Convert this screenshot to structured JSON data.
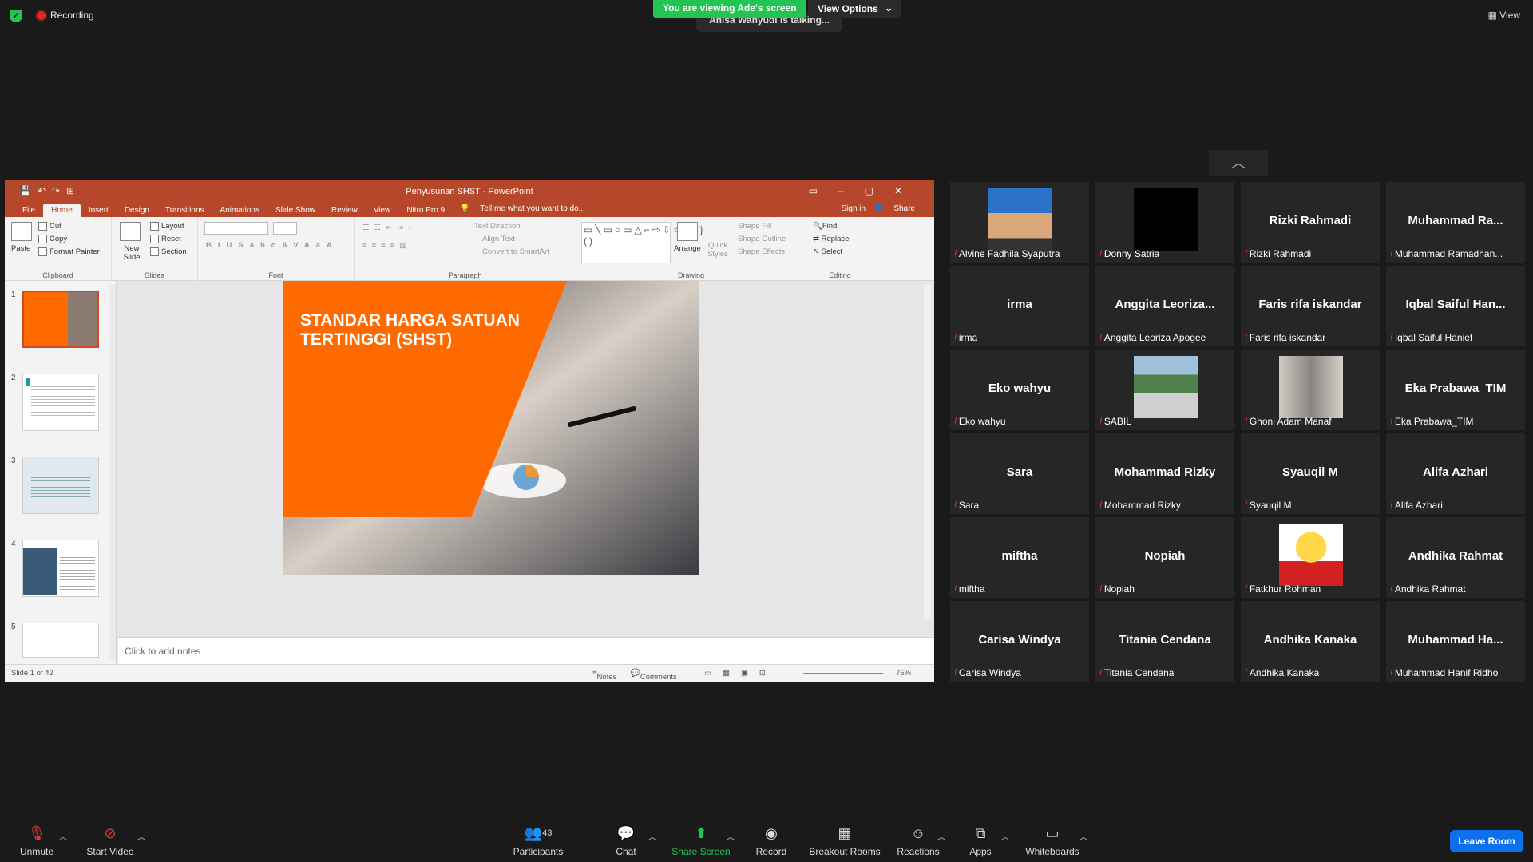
{
  "meeting": {
    "recording_label": "Recording",
    "viewing_banner": "You are viewing Ade's screen",
    "view_options_label": "View Options",
    "talking_indicator": "Anisa Wahyudi is talking...",
    "view_button": "View"
  },
  "ppt": {
    "window_title": "Penyusunan SHST - PowerPoint",
    "tabs": [
      "File",
      "Home",
      "Insert",
      "Design",
      "Transitions",
      "Animations",
      "Slide Show",
      "Review",
      "View",
      "Nitro Pro 9"
    ],
    "active_tab": "Home",
    "tell_me": "Tell me what you want to do...",
    "sign_in": "Sign in",
    "share": "Share",
    "ribbon": {
      "clipboard": {
        "paste": "Paste",
        "cut": "Cut",
        "copy": "Copy",
        "format_painter": "Format Painter",
        "label": "Clipboard"
      },
      "slides": {
        "new_slide": "New Slide",
        "layout": "Layout",
        "reset": "Reset",
        "section": "Section",
        "label": "Slides"
      },
      "font": {
        "label": "Font"
      },
      "paragraph": {
        "text_direction": "Text Direction",
        "align_text": "Align Text",
        "convert_smartart": "Convert to SmartArt",
        "label": "Paragraph"
      },
      "drawing": {
        "arrange": "Arrange",
        "quick_styles": "Quick Styles",
        "shape_fill": "Shape Fill",
        "shape_outline": "Shape Outline",
        "shape_effects": "Shape Effects",
        "label": "Drawing"
      },
      "editing": {
        "find": "Find",
        "replace": "Replace",
        "select": "Select",
        "label": "Editing"
      }
    },
    "thumbnail_numbers": [
      "1",
      "2",
      "3",
      "4",
      "5"
    ],
    "slide_title_line1": "STANDAR HARGA SATUAN",
    "slide_title_line2": "TERTINGGI (SHST)",
    "notes_placeholder": "Click to add notes",
    "status": {
      "slide_info": "Slide 1 of 42",
      "notes": "Notes",
      "comments": "Comments",
      "zoom": "75%"
    }
  },
  "participants": [
    {
      "name": "",
      "label": "Alvine Fadhila Syaputra",
      "avatar": "photo-person"
    },
    {
      "name": "",
      "label": "Donny Satria",
      "avatar": "black"
    },
    {
      "name": "Rizki Rahmadi",
      "label": "Rizki Rahmadi"
    },
    {
      "name": "Muhammad  Ra...",
      "label": "Muhammad Ramadhan..."
    },
    {
      "name": "irma",
      "label": "irma"
    },
    {
      "name": "Anggita  Leoriza...",
      "label": "Anggita Leoriza Apogee"
    },
    {
      "name": "Faris rifa iskandar",
      "label": "Faris rifa iskandar"
    },
    {
      "name": "Iqbal  Saiful  Han...",
      "label": "Iqbal Saiful Hanief"
    },
    {
      "name": "Eko wahyu",
      "label": "Eko wahyu"
    },
    {
      "name": "",
      "label": "SABIL",
      "avatar": "photo-aerial"
    },
    {
      "name": "",
      "label": "Ghoni Adam Manaf",
      "avatar": "photo-room"
    },
    {
      "name": "Eka Prabawa_TIM",
      "label": "Eka Prabawa_TIM"
    },
    {
      "name": "Sara",
      "label": "Sara"
    },
    {
      "name": "Mohammad Rizky",
      "label": "Mohammad Rizky"
    },
    {
      "name": "Syauqil M",
      "label": "Syauqil M"
    },
    {
      "name": "Alifa Azhari",
      "label": "Alifa Azhari"
    },
    {
      "name": "miftha",
      "label": "miftha"
    },
    {
      "name": "Nopiah",
      "label": "Nopiah"
    },
    {
      "name": "",
      "label": "Fatkhur Rohman",
      "avatar": "emoji-reader"
    },
    {
      "name": "Andhika Rahmat",
      "label": "Andhika Rahmat"
    },
    {
      "name": "Carisa Windya",
      "label": "Carisa Windya"
    },
    {
      "name": "Titania Cendana",
      "label": "Titania Cendana"
    },
    {
      "name": "Andhika Kanaka",
      "label": "Andhika Kanaka"
    },
    {
      "name": "Muhammad  Ha...",
      "label": "Muhammad Hanif Ridho"
    }
  ],
  "toolbar": {
    "unmute": "Unmute",
    "start_video": "Start Video",
    "participants": "Participants",
    "participants_count": "43",
    "chat": "Chat",
    "share_screen": "Share Screen",
    "record": "Record",
    "breakout": "Breakout Rooms",
    "reactions": "Reactions",
    "apps": "Apps",
    "whiteboards": "Whiteboards",
    "leave": "Leave Room"
  },
  "colors": {
    "accent_green": "#23c552",
    "ppt_red": "#b7472a",
    "slide_orange": "#ff6a00",
    "leave_blue": "#0e71eb",
    "mic_red": "#e53935"
  }
}
